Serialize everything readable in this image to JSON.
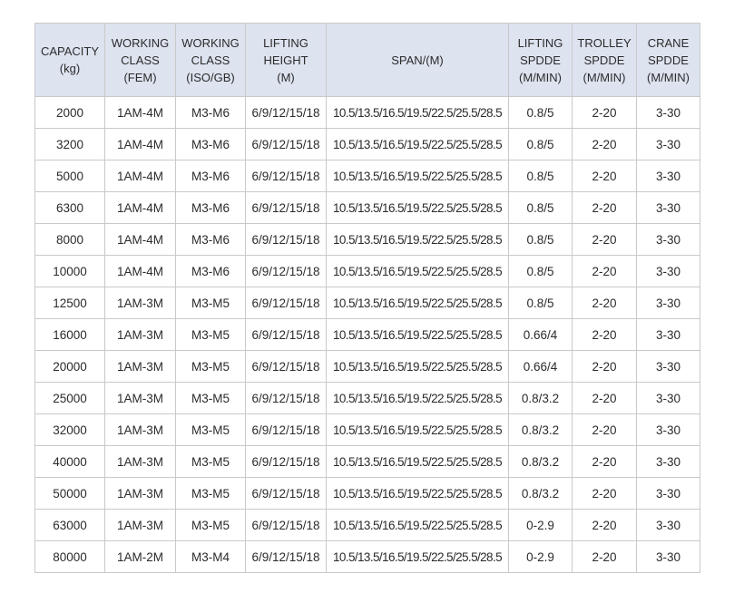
{
  "table": {
    "headers": [
      [
        "CAPACITY",
        "(kg)"
      ],
      [
        "WORKING",
        "CLASS",
        "(FEM)"
      ],
      [
        "WORKING",
        "CLASS",
        "(ISO/GB)"
      ],
      [
        "LIFTING",
        "HEIGHT",
        "(M)"
      ],
      [
        "SPAN/(M)"
      ],
      [
        "LIFTING",
        "SPDDE",
        "(M/MIN)"
      ],
      [
        "TROLLEY",
        "SPDDE",
        "(M/MIN)"
      ],
      [
        "CRANE",
        "SPDDE",
        "(M/MIN)"
      ]
    ],
    "rows": [
      [
        "2000",
        "1AM-4M",
        "M3-M6",
        "6/9/12/15/18",
        "10.5/13.5/16.5/19.5/22.5/25.5/28.5",
        "0.8/5",
        "2-20",
        "3-30"
      ],
      [
        "3200",
        "1AM-4M",
        "M3-M6",
        "6/9/12/15/18",
        "10.5/13.5/16.5/19.5/22.5/25.5/28.5",
        "0.8/5",
        "2-20",
        "3-30"
      ],
      [
        "5000",
        "1AM-4M",
        "M3-M6",
        "6/9/12/15/18",
        "10.5/13.5/16.5/19.5/22.5/25.5/28.5",
        "0.8/5",
        "2-20",
        "3-30"
      ],
      [
        "6300",
        "1AM-4M",
        "M3-M6",
        "6/9/12/15/18",
        "10.5/13.5/16.5/19.5/22.5/25.5/28.5",
        "0.8/5",
        "2-20",
        "3-30"
      ],
      [
        "8000",
        "1AM-4M",
        "M3-M6",
        "6/9/12/15/18",
        "10.5/13.5/16.5/19.5/22.5/25.5/28.5",
        "0.8/5",
        "2-20",
        "3-30"
      ],
      [
        "10000",
        "1AM-4M",
        "M3-M6",
        "6/9/12/15/18",
        "10.5/13.5/16.5/19.5/22.5/25.5/28.5",
        "0.8/5",
        "2-20",
        "3-30"
      ],
      [
        "12500",
        "1AM-3M",
        "M3-M5",
        "6/9/12/15/18",
        "10.5/13.5/16.5/19.5/22.5/25.5/28.5",
        "0.8/5",
        "2-20",
        "3-30"
      ],
      [
        "16000",
        "1AM-3M",
        "M3-M5",
        "6/9/12/15/18",
        "10.5/13.5/16.5/19.5/22.5/25.5/28.5",
        "0.66/4",
        "2-20",
        "3-30"
      ],
      [
        "20000",
        "1AM-3M",
        "M3-M5",
        "6/9/12/15/18",
        "10.5/13.5/16.5/19.5/22.5/25.5/28.5",
        "0.66/4",
        "2-20",
        "3-30"
      ],
      [
        "25000",
        "1AM-3M",
        "M3-M5",
        "6/9/12/15/18",
        "10.5/13.5/16.5/19.5/22.5/25.5/28.5",
        "0.8/3.2",
        "2-20",
        "3-30"
      ],
      [
        "32000",
        "1AM-3M",
        "M3-M5",
        "6/9/12/15/18",
        "10.5/13.5/16.5/19.5/22.5/25.5/28.5",
        "0.8/3.2",
        "2-20",
        "3-30"
      ],
      [
        "40000",
        "1AM-3M",
        "M3-M5",
        "6/9/12/15/18",
        "10.5/13.5/16.5/19.5/22.5/25.5/28.5",
        "0.8/3.2",
        "2-20",
        "3-30"
      ],
      [
        "50000",
        "1AM-3M",
        "M3-M5",
        "6/9/12/15/18",
        "10.5/13.5/16.5/19.5/22.5/25.5/28.5",
        "0.8/3.2",
        "2-20",
        "3-30"
      ],
      [
        "63000",
        "1AM-3M",
        "M3-M5",
        "6/9/12/15/18",
        "10.5/13.5/16.5/19.5/22.5/25.5/28.5",
        "0-2.9",
        "2-20",
        "3-30"
      ],
      [
        "80000",
        "1AM-2M",
        "M3-M4",
        "6/9/12/15/18",
        "10.5/13.5/16.5/19.5/22.5/25.5/28.5",
        "0-2.9",
        "2-20",
        "3-30"
      ]
    ]
  },
  "colors": {
    "header_bg": "#dde3ef",
    "border": "#c9c9c9",
    "text": "#2b2b2b"
  }
}
